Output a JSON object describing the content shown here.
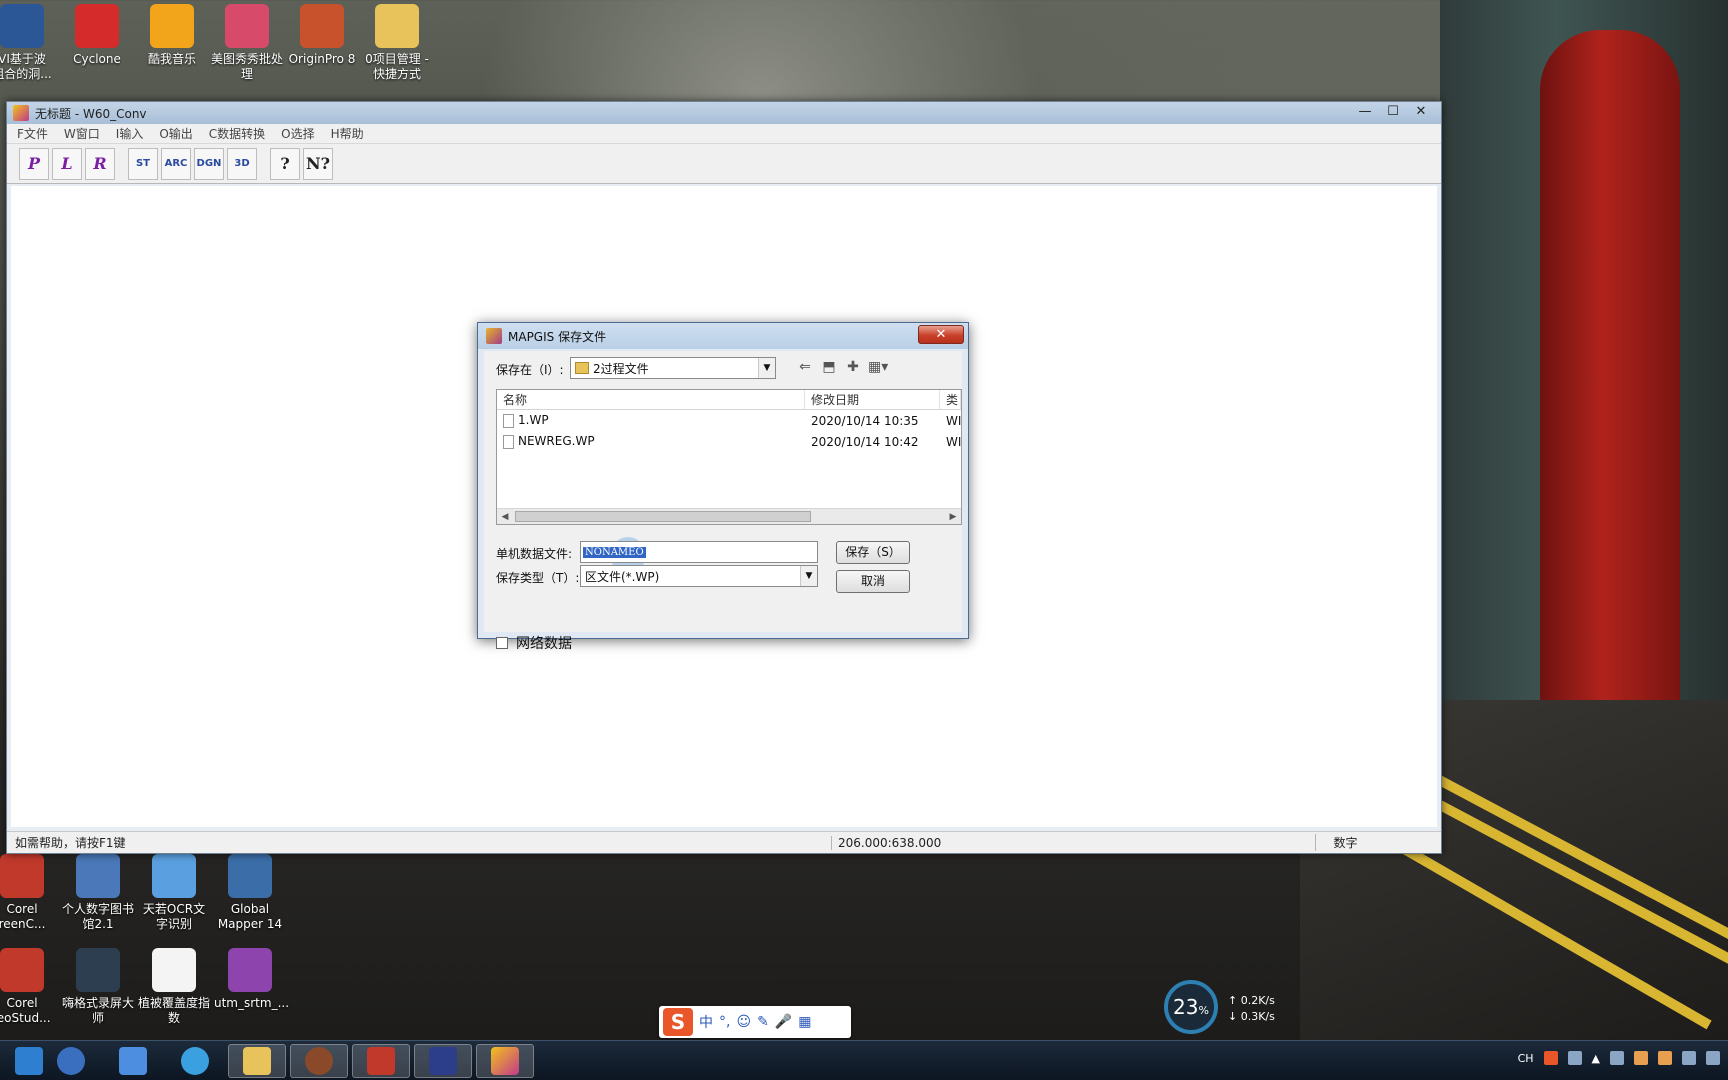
{
  "desktop": {
    "icons_top": [
      {
        "label": "VI基于波\n组合的洞...",
        "icon": "word-doc-icon",
        "color": "#2b5797"
      },
      {
        "label": "Cyclone",
        "icon": "cyclone-icon",
        "color": "#d62b2b"
      },
      {
        "label": "酷我音乐",
        "icon": "kuwo-music-icon",
        "color": "#f2a51a"
      },
      {
        "label": "美图秀秀批处理",
        "icon": "meitu-batch-icon",
        "color": "#d84a6a"
      },
      {
        "label": "OriginPro 8",
        "icon": "originpro-icon",
        "color": "#c8522c"
      },
      {
        "label": "0项目管理 - 快捷方式",
        "icon": "folder-shortcut-icon",
        "color": "#e8c25a"
      }
    ],
    "icons_bottom_row1": [
      {
        "label": "Corel\nreenC...",
        "icon": "corel-screencap-icon",
        "color": "#c0392b"
      },
      {
        "label": "个人数字图书馆2.1",
        "icon": "digital-library-icon",
        "color": "#4a78b8"
      },
      {
        "label": "天若OCR文字识别",
        "icon": "ocr-icon",
        "color": "#5aa0e0"
      },
      {
        "label": "Global Mapper 14",
        "icon": "global-mapper-icon",
        "color": "#3b6ea8"
      }
    ],
    "icons_bottom_row2": [
      {
        "label": "Corel\nleoStud...",
        "icon": "corel-videostudio-icon",
        "color": "#c0392b"
      },
      {
        "label": "嗨格式录屏大师",
        "icon": "screen-recorder-icon",
        "color": "#2c3e50"
      },
      {
        "label": "植被覆盖度指数",
        "icon": "text-file-icon",
        "color": "#f4f4f4"
      },
      {
        "label": "utm_srtm_...",
        "icon": "winrar-icon",
        "color": "#8e44ad"
      }
    ]
  },
  "main_window": {
    "title": "无标题 - W60_Conv",
    "controls": {
      "minimize": "—",
      "maximize": "☐",
      "close": "✕"
    },
    "menu": [
      "F文件",
      "W窗口",
      "I输入",
      "O输出",
      "C数据转换",
      "O选择",
      "H帮助"
    ],
    "toolbar": [
      {
        "label": "P",
        "icon": "point-tool-icon"
      },
      {
        "label": "L",
        "icon": "line-tool-icon"
      },
      {
        "label": "R",
        "icon": "region-tool-icon"
      },
      {
        "label": "ST",
        "icon": "st-convert-icon"
      },
      {
        "label": "ARC",
        "icon": "arc-convert-icon"
      },
      {
        "label": "DGN",
        "icon": "dgn-convert-icon"
      },
      {
        "label": "3D",
        "icon": "3d-convert-icon"
      },
      {
        "label": "?",
        "icon": "help-icon"
      },
      {
        "label": "N?",
        "icon": "context-help-icon"
      }
    ],
    "status": {
      "help": "如需帮助，请按F1键",
      "coords": "206.000:638.000",
      "mode": "数字"
    }
  },
  "dialog": {
    "title": "MAPGIS 保存文件",
    "close": "✕",
    "save_in_label": "保存在（I）:",
    "save_in_value": "2过程文件",
    "columns": [
      "名称",
      "修改日期",
      "类"
    ],
    "files": [
      {
        "name": "1.WP",
        "date": "2020/10/14 10:35",
        "type": "WI"
      },
      {
        "name": "NEWREG.WP",
        "date": "2020/10/14 10:42",
        "type": "WI"
      }
    ],
    "filename_label": "单机数据文件:",
    "filename_value": "NONAMEO",
    "filetype_label": "保存类型（T）:",
    "filetype_value": "区文件(*.WP)",
    "save_button": "保存（S）",
    "cancel_button": "取消",
    "network_checkbox": "网络数据"
  },
  "ime_bar": {
    "logo": "S",
    "items": [
      "中",
      "°,",
      "☺",
      "✎",
      "🎤",
      "▦"
    ]
  },
  "net_monitor": {
    "percent": "23",
    "percent_unit": "%",
    "up": "0.2K/s",
    "down": "0.3K/s"
  },
  "tray": {
    "lang": "CH"
  }
}
